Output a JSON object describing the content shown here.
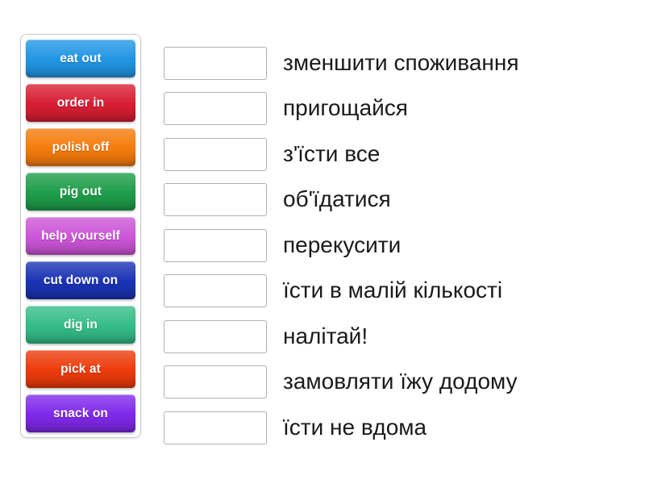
{
  "activity": {
    "type": "match-up",
    "tiles_panel": {
      "name": "draggable-terms",
      "tiles": [
        {
          "label": "eat out",
          "color": "#2196e3"
        },
        {
          "label": "order in",
          "color": "#d91e33"
        },
        {
          "label": "polish off",
          "color": "#f57c0c"
        },
        {
          "label": "pig out",
          "color": "#1e9e4a"
        },
        {
          "label": "help yourself",
          "color": "#cc55d8"
        },
        {
          "label": "cut down on",
          "color": "#1b33b5"
        },
        {
          "label": "dig in",
          "color": "#35bd89"
        },
        {
          "label": "pick at",
          "color": "#ee3b0c"
        },
        {
          "label": "snack on",
          "color": "#8029ea"
        }
      ]
    },
    "rows": [
      {
        "dropzone_value": "",
        "definition": "зменшити споживання"
      },
      {
        "dropzone_value": "",
        "definition": "пригощайся"
      },
      {
        "dropzone_value": "",
        "definition": "з'їсти все"
      },
      {
        "dropzone_value": "",
        "definition": "об'їдатися"
      },
      {
        "dropzone_value": "",
        "definition": "перекусити"
      },
      {
        "dropzone_value": "",
        "definition": "їсти в малій кількості"
      },
      {
        "dropzone_value": "",
        "definition": "налітай!"
      },
      {
        "dropzone_value": "",
        "definition": "замовляти їжу додому"
      },
      {
        "dropzone_value": "",
        "definition": "їсти не вдома"
      }
    ]
  },
  "colors": {
    "page_background": "#ffffff",
    "panel_border": "#c9c9c9",
    "dropzone_border": "#b0b0b0",
    "definition_text": "#1a1a1a",
    "tile_text": "#ffffff"
  }
}
